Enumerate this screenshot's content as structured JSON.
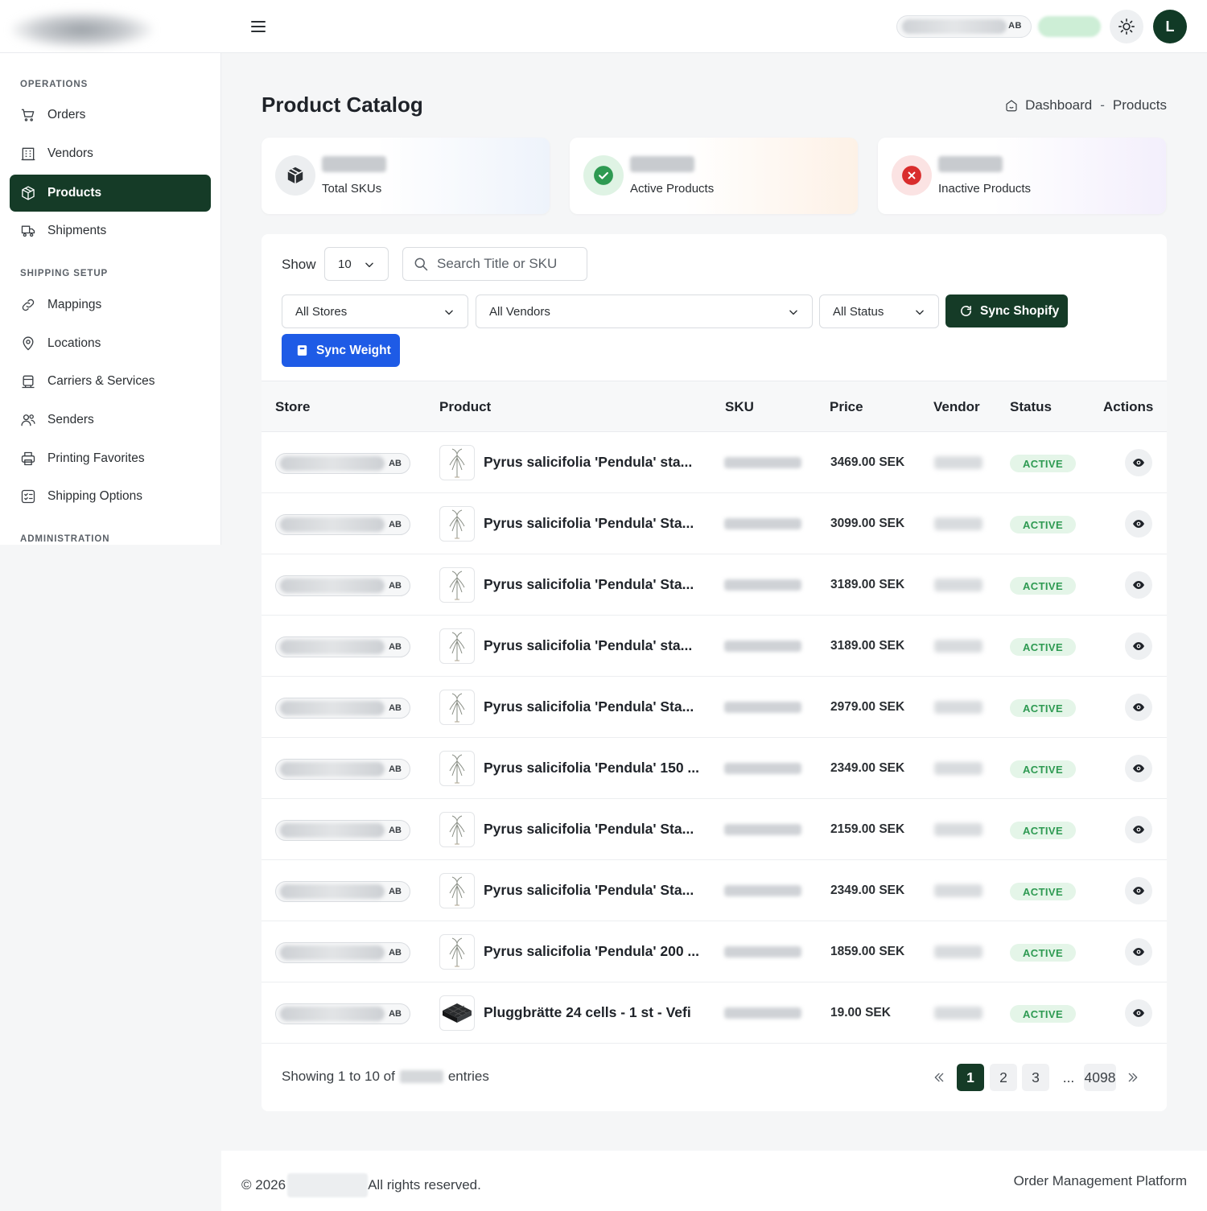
{
  "header": {
    "store_badge": "AB",
    "avatar_initial": "L"
  },
  "sidebar": {
    "sections": [
      {
        "label": "OPERATIONS"
      },
      {
        "label": "SHIPPING SETUP"
      },
      {
        "label": "ADMINISTRATION"
      }
    ],
    "items": [
      {
        "label": "Orders",
        "icon": "cart-icon"
      },
      {
        "label": "Vendors",
        "icon": "building-icon"
      },
      {
        "label": "Products",
        "icon": "box-icon",
        "active": true
      },
      {
        "label": "Shipments",
        "icon": "truck-icon"
      },
      {
        "label": "Mappings",
        "icon": "link-icon"
      },
      {
        "label": "Locations",
        "icon": "location-pin-icon"
      },
      {
        "label": "Carriers & Services",
        "icon": "carrier-icon"
      },
      {
        "label": "Senders",
        "icon": "users-icon"
      },
      {
        "label": "Printing Favorites",
        "icon": "printer-icon"
      },
      {
        "label": "Shipping Options",
        "icon": "checklist-icon"
      }
    ]
  },
  "page": {
    "title": "Product Catalog",
    "breadcrumb": {
      "home": "Dashboard",
      "separator": "-",
      "current": "Products"
    }
  },
  "stats": [
    {
      "label": "Total SKUs",
      "icon": "cube-icon",
      "color": "#2b2f33"
    },
    {
      "label": "Active Products",
      "icon": "check-circle-icon",
      "color": "#2e9a52"
    },
    {
      "label": "Inactive Products",
      "icon": "x-circle-icon",
      "color": "#d92d2d"
    }
  ],
  "filters": {
    "show_label": "Show",
    "page_size": "10",
    "search_placeholder": "Search Title or SKU",
    "stores": "All Stores",
    "vendors": "All Vendors",
    "status": "All Status",
    "sync_shopify": "Sync Shopify",
    "sync_weight": "Sync Weight"
  },
  "table": {
    "columns": [
      "Store",
      "Product",
      "SKU",
      "Price",
      "Vendor",
      "Status",
      "Actions"
    ],
    "rows": [
      {
        "store": "AB",
        "product": "Pyrus salicifolia 'Pendula' sta...",
        "price": "3469.00 SEK",
        "status": "ACTIVE",
        "thumb": "tree"
      },
      {
        "store": "AB",
        "product": "Pyrus salicifolia 'Pendula' Sta...",
        "price": "3099.00 SEK",
        "status": "ACTIVE",
        "thumb": "tree"
      },
      {
        "store": "AB",
        "product": "Pyrus salicifolia 'Pendula' Sta...",
        "price": "3189.00 SEK",
        "status": "ACTIVE",
        "thumb": "tree"
      },
      {
        "store": "AB",
        "product": "Pyrus salicifolia 'Pendula' sta...",
        "price": "3189.00 SEK",
        "status": "ACTIVE",
        "thumb": "tree"
      },
      {
        "store": "AB",
        "product": "Pyrus salicifolia 'Pendula' Sta...",
        "price": "2979.00 SEK",
        "status": "ACTIVE",
        "thumb": "tree"
      },
      {
        "store": "AB",
        "product": "Pyrus salicifolia 'Pendula' 150 ...",
        "price": "2349.00 SEK",
        "status": "ACTIVE",
        "thumb": "tree"
      },
      {
        "store": "AB",
        "product": "Pyrus salicifolia 'Pendula' Sta...",
        "price": "2159.00 SEK",
        "status": "ACTIVE",
        "thumb": "tree"
      },
      {
        "store": "AB",
        "product": "Pyrus salicifolia 'Pendula' Sta...",
        "price": "2349.00 SEK",
        "status": "ACTIVE",
        "thumb": "tree"
      },
      {
        "store": "AB",
        "product": "Pyrus salicifolia 'Pendula' 200 ...",
        "price": "1859.00 SEK",
        "status": "ACTIVE",
        "thumb": "tree"
      },
      {
        "store": "AB",
        "product": "Pluggbrätte 24 cells - 1 st - Vefi",
        "price": "19.00 SEK",
        "status": "ACTIVE",
        "thumb": "tray"
      }
    ]
  },
  "pagination": {
    "showing_prefix": "Showing 1 to 10 of",
    "showing_suffix": "entries",
    "pages": [
      "1",
      "2",
      "3"
    ],
    "ellipsis": "...",
    "last_page": "4098",
    "current": "1"
  },
  "footer": {
    "copyright": "© 2026",
    "rights": "All rights reserved.",
    "platform": "Order Management Platform"
  }
}
